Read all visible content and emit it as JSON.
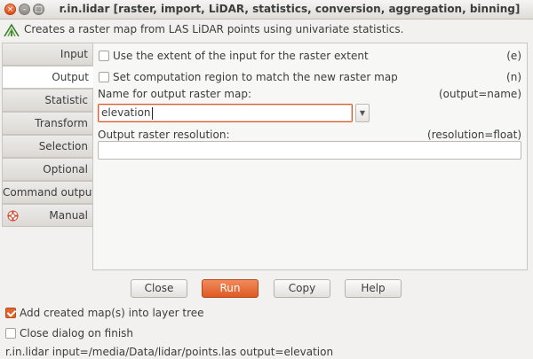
{
  "window": {
    "title": "r.in.lidar [raster, import, LiDAR, statistics, conversion, aggregation, binning]",
    "description": "Creates a raster map from LAS LiDAR points using univariate statistics."
  },
  "tabs": [
    {
      "label": "Input"
    },
    {
      "label": "Output"
    },
    {
      "label": "Statistic"
    },
    {
      "label": "Transform"
    },
    {
      "label": "Selection"
    },
    {
      "label": "Optional"
    },
    {
      "label": "Command output"
    },
    {
      "label": "Manual"
    }
  ],
  "active_tab": "Output",
  "options": {
    "extent_label": "Use the extent of the input for the raster extent",
    "extent_flag": "(e)",
    "region_label": "Set computation region to match the new raster map",
    "region_flag": "(n)",
    "output_label": "Name for output raster map:",
    "output_hint": "(output=name)",
    "output_value": "elevation",
    "resolution_label": "Output raster resolution:",
    "resolution_hint": "(resolution=float)",
    "resolution_value": ""
  },
  "buttons": {
    "close": "Close",
    "run": "Run",
    "copy": "Copy",
    "help": "Help"
  },
  "bottom": {
    "add_layer_label": "Add created map(s) into layer tree",
    "add_layer_checked": true,
    "close_dialog_label": "Close dialog on finish",
    "close_dialog_checked": false,
    "command": "r.in.lidar input=/media/Data/lidar/points.las output=elevation"
  },
  "colors": {
    "accent": "#df5a24",
    "focus_border": "#d85a2a"
  }
}
